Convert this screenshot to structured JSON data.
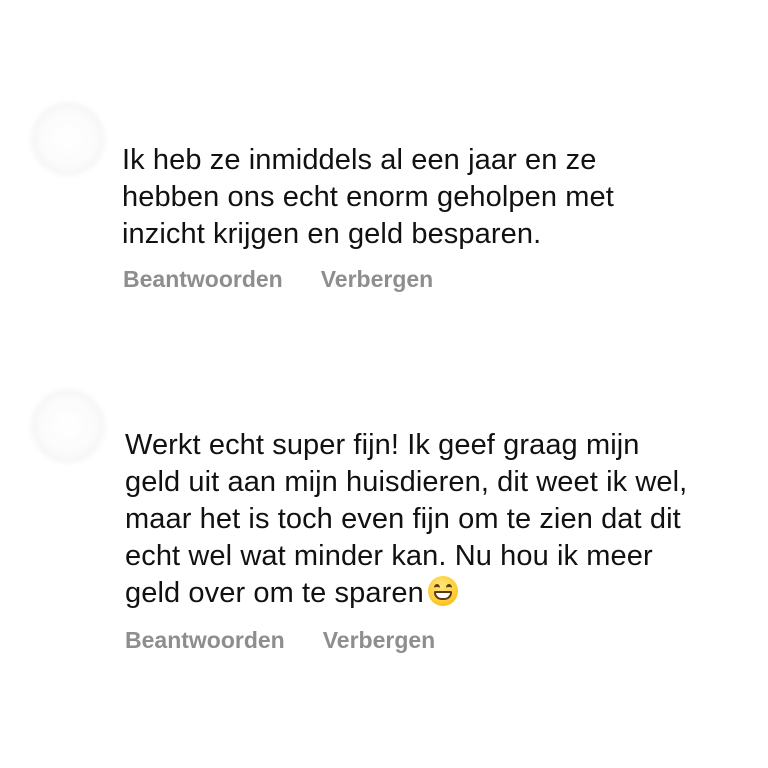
{
  "comments": [
    {
      "lines": [
        "Ik heb ze inmiddels al een jaar en ze",
        "hebben ons echt enorm geholpen met",
        "inzicht krijgen en geld besparen."
      ],
      "reply_label": "Beantwoorden",
      "hide_label": "Verbergen"
    },
    {
      "lines": [
        "Werkt echt super fijn! Ik geef graag mijn",
        "geld uit aan mijn huisdieren, dit weet ik wel,",
        "maar het is toch even fijn om te zien dat dit",
        "echt wel wat minder kan. Nu hou ik meer",
        "geld over om te sparen"
      ],
      "emoji": "grinning-face-with-smiling-eyes-icon",
      "reply_label": "Beantwoorden",
      "hide_label": "Verbergen"
    }
  ],
  "colors": {
    "text": "#111111",
    "action": "#8e8e8e",
    "background": "#ffffff"
  }
}
